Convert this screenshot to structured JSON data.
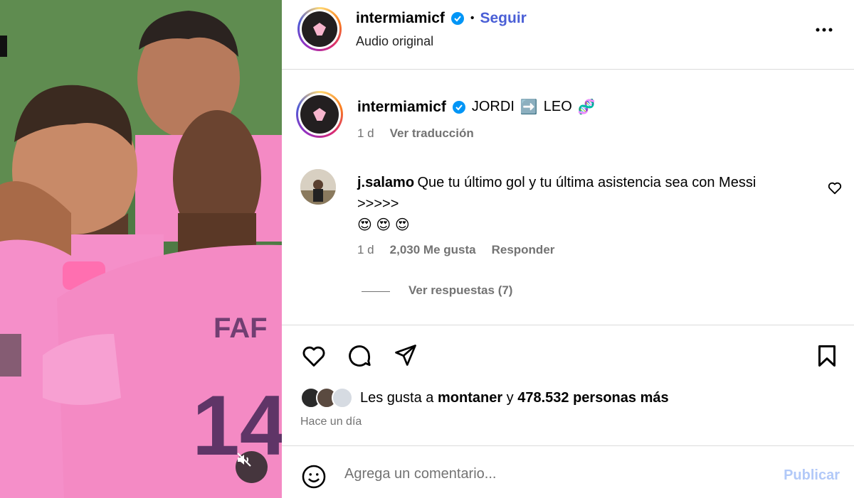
{
  "post": {
    "author": "intermiamicf",
    "follow_label": "Seguir",
    "separator": "•",
    "audio_label": "Audio original",
    "more_icon": "more-horizontal-icon"
  },
  "caption": {
    "author": "intermiamicf",
    "text_part1": "JORDI",
    "arrow_emoji": "➡️",
    "text_part2": "LEO",
    "dna_emoji": "🧬",
    "age": "1 d",
    "translate_label": "Ver traducción"
  },
  "comment": {
    "author": "j.salamo",
    "text": "Que tu último gol y tu última asistencia sea con Messi",
    "text_line2": ">>>>>",
    "emojis": "😍 😍 😍",
    "age": "1 d",
    "likes": "2,030 Me gusta",
    "reply_label": "Responder",
    "view_replies": "Ver respuestas (7)"
  },
  "actions": {
    "like_icon": "heart-icon",
    "comment_icon": "comment-icon",
    "share_icon": "share-icon",
    "save_icon": "bookmark-icon"
  },
  "likes": {
    "prefix": "Les gusta a",
    "user": "montaner",
    "connector": "y",
    "count": "478.532 personas más",
    "time": "Hace un día"
  },
  "composer": {
    "placeholder": "Agrega un comentario...",
    "publish_label": "Publicar",
    "emoji_icon": "smiley-icon"
  },
  "colors": {
    "accent": "#4a5fd6",
    "publish_disabled": "#b2c9f8",
    "verified": "#0095f6",
    "jersey_pink": "#f58fc9",
    "muted": "#737373"
  }
}
